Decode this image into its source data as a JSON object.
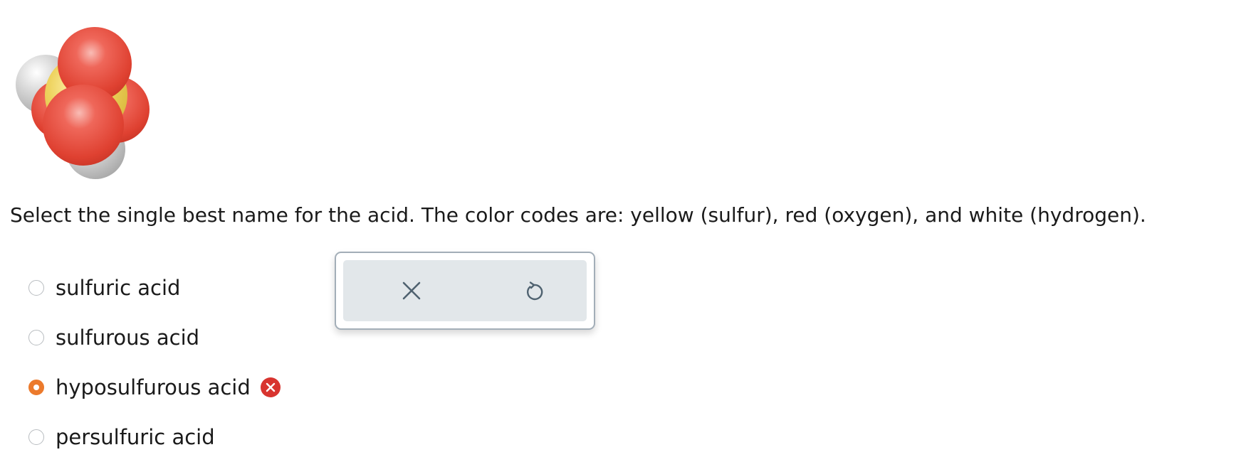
{
  "question": {
    "prompt": "Select the single best name for the acid. The color codes are: yellow (sulfur), red (oxygen), and white (hydrogen).",
    "color_codes": {
      "sulfur": "#e7cf5c",
      "oxygen": "#e34b3c",
      "hydrogen": "#c8c8c8"
    }
  },
  "choices": [
    {
      "label": "sulfuric acid",
      "selected": false,
      "marked_wrong": false
    },
    {
      "label": "sulfurous acid",
      "selected": false,
      "marked_wrong": false
    },
    {
      "label": "hyposulfurous acid",
      "selected": true,
      "marked_wrong": true
    },
    {
      "label": "persulfuric acid",
      "selected": false,
      "marked_wrong": false
    }
  ],
  "toolbar": {
    "clear_icon": "x-icon",
    "undo_icon": "undo-icon"
  },
  "colors": {
    "selected_accent": "#ec7a2c",
    "wrong_badge": "#d8342f",
    "toolbar_icon": "#4f6270",
    "toolbar_bg": "#e2e7ea",
    "toolbar_border": "#a3aeb8"
  }
}
